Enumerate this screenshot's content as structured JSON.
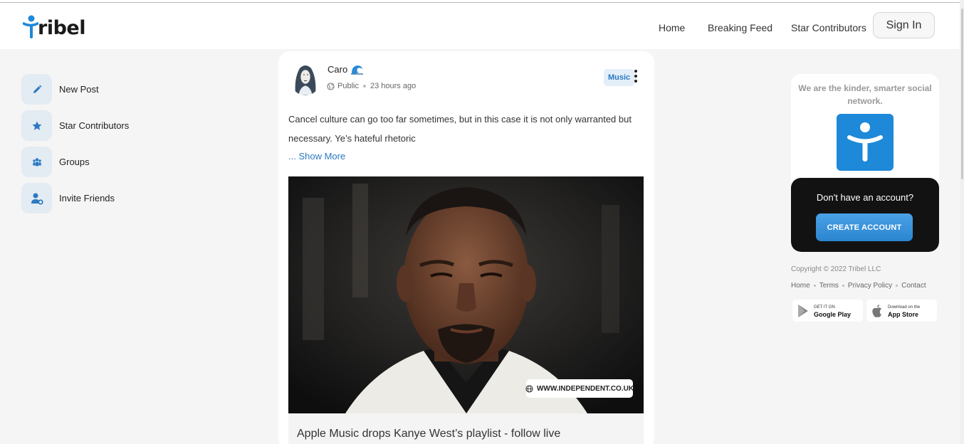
{
  "header": {
    "logo_text": "ribel",
    "nav": [
      "Home",
      "Breaking Feed",
      "Star Contributors"
    ],
    "signin_label": "Sign In"
  },
  "sidebar": {
    "items": [
      {
        "label": "New Post",
        "icon": "pencil-icon"
      },
      {
        "label": "Star Contributors",
        "icon": "star-icon"
      },
      {
        "label": "Groups",
        "icon": "groups-icon"
      },
      {
        "label": "Invite Friends",
        "icon": "add-user-icon"
      }
    ]
  },
  "post": {
    "author": "Caro",
    "visibility": "Public",
    "time": "23 hours ago",
    "tag": "Music",
    "text": "Cancel culture can go too far sometimes, but in this case it is not only warranted but necessary. Ye’s hateful rhetoric",
    "show_more": "... Show More",
    "source": "WWW.INDEPENDENT.CO.UK",
    "link_title": "Apple Music drops Kanye West’s playlist - follow live"
  },
  "right": {
    "tagline": "We are the kinder, smarter social network.",
    "no_account": "Don't have an account?",
    "create_label": "CREATE ACCOUNT",
    "copyright": "Copyright © 2022 Tribel LLC",
    "footer_links": [
      "Home",
      "Terms",
      "Privacy Policy",
      "Contact"
    ],
    "google_small": "GET IT ON",
    "google_big": "Google Play",
    "apple_small": "Download on the",
    "apple_big": "App Store"
  },
  "colors": {
    "brand_blue": "#1e88d9",
    "link_blue": "#2b79c2",
    "dark_panel": "#121212"
  }
}
